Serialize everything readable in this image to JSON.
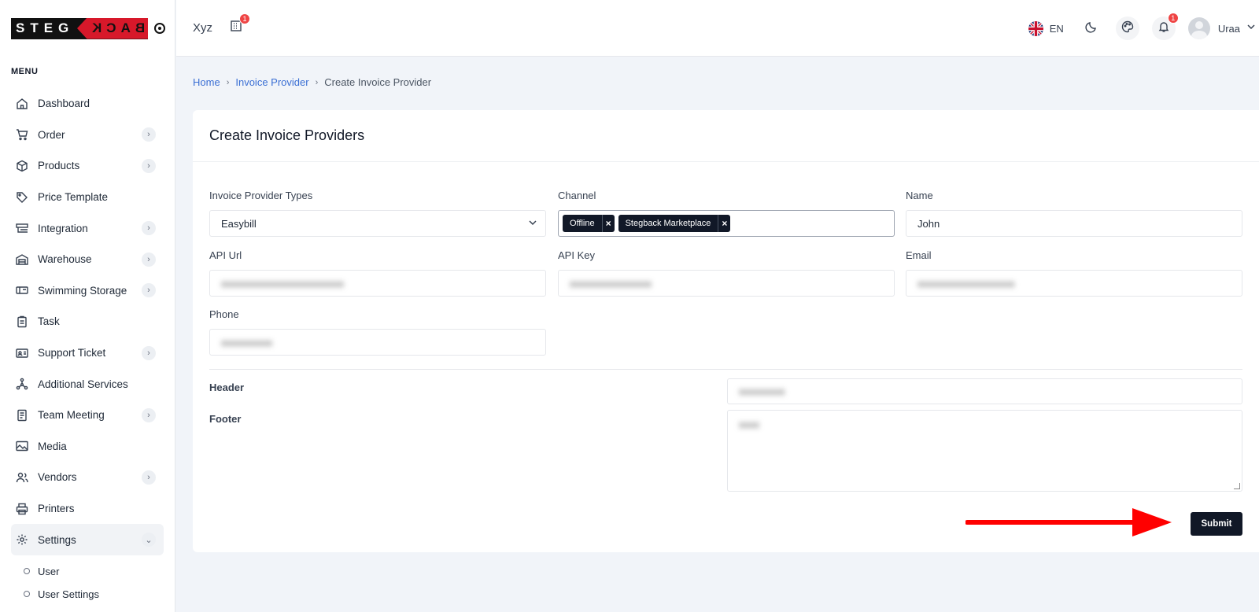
{
  "brand": {
    "name_left": "STEG",
    "name_right": "BACK"
  },
  "sidebar": {
    "menu_title": "MENU",
    "items": [
      {
        "label": "Dashboard",
        "icon": "home-icon",
        "has_submenu": false
      },
      {
        "label": "Order",
        "icon": "cart-icon",
        "has_submenu": true
      },
      {
        "label": "Products",
        "icon": "box-icon",
        "has_submenu": true
      },
      {
        "label": "Price Template",
        "icon": "tag-icon",
        "has_submenu": false
      },
      {
        "label": "Integration",
        "icon": "integration-icon",
        "has_submenu": true
      },
      {
        "label": "Warehouse",
        "icon": "warehouse-icon",
        "has_submenu": true
      },
      {
        "label": "Swimming Storage",
        "icon": "storage-icon",
        "has_submenu": true
      },
      {
        "label": "Task",
        "icon": "clipboard-icon",
        "has_submenu": false
      },
      {
        "label": "Support Ticket",
        "icon": "id-card-icon",
        "has_submenu": true
      },
      {
        "label": "Additional Services",
        "icon": "network-icon",
        "has_submenu": false
      },
      {
        "label": "Team Meeting",
        "icon": "notebook-icon",
        "has_submenu": true
      },
      {
        "label": "Media",
        "icon": "image-icon",
        "has_submenu": false
      },
      {
        "label": "Vendors",
        "icon": "users-icon",
        "has_submenu": true
      },
      {
        "label": "Printers",
        "icon": "printer-icon",
        "has_submenu": false
      },
      {
        "label": "Settings",
        "icon": "gear-icon",
        "has_submenu": true,
        "expanded": true
      }
    ],
    "settings_sub": [
      "User",
      "User Settings"
    ]
  },
  "topbar": {
    "company": "Xyz",
    "company_badge": "1",
    "language": "EN",
    "notification_badge": "1",
    "user_name": "Uraa"
  },
  "breadcrumb": {
    "home": "Home",
    "parent": "Invoice Provider",
    "current": "Create Invoice Provider"
  },
  "form": {
    "title": "Create Invoice Providers",
    "provider_type": {
      "label": "Invoice Provider Types",
      "value": "Easybill"
    },
    "channel": {
      "label": "Channel",
      "tags": [
        "Offline",
        "Stegback Marketplace"
      ]
    },
    "name": {
      "label": "Name",
      "value": "John"
    },
    "api_url": {
      "label": "API Url",
      "value": "xxxxxxxxxxxxxxxxxxxxxxxx"
    },
    "api_key": {
      "label": "API Key",
      "value": "xxxxxxxxxxxxxxxx"
    },
    "email": {
      "label": "Email",
      "value": "xxxxxxxxxxxxxxxxxxx"
    },
    "phone": {
      "label": "Phone",
      "value": "xxxxxxxxxx"
    },
    "header": {
      "label": "Header",
      "value": "xxxxxxxxx"
    },
    "footer": {
      "label": "Footer",
      "value": "xxxx"
    },
    "submit_label": "Submit"
  },
  "colors": {
    "accent_dark": "#111827",
    "link": "#3b6fd4",
    "badge": "#ef4444",
    "arrow": "#ff0000"
  }
}
